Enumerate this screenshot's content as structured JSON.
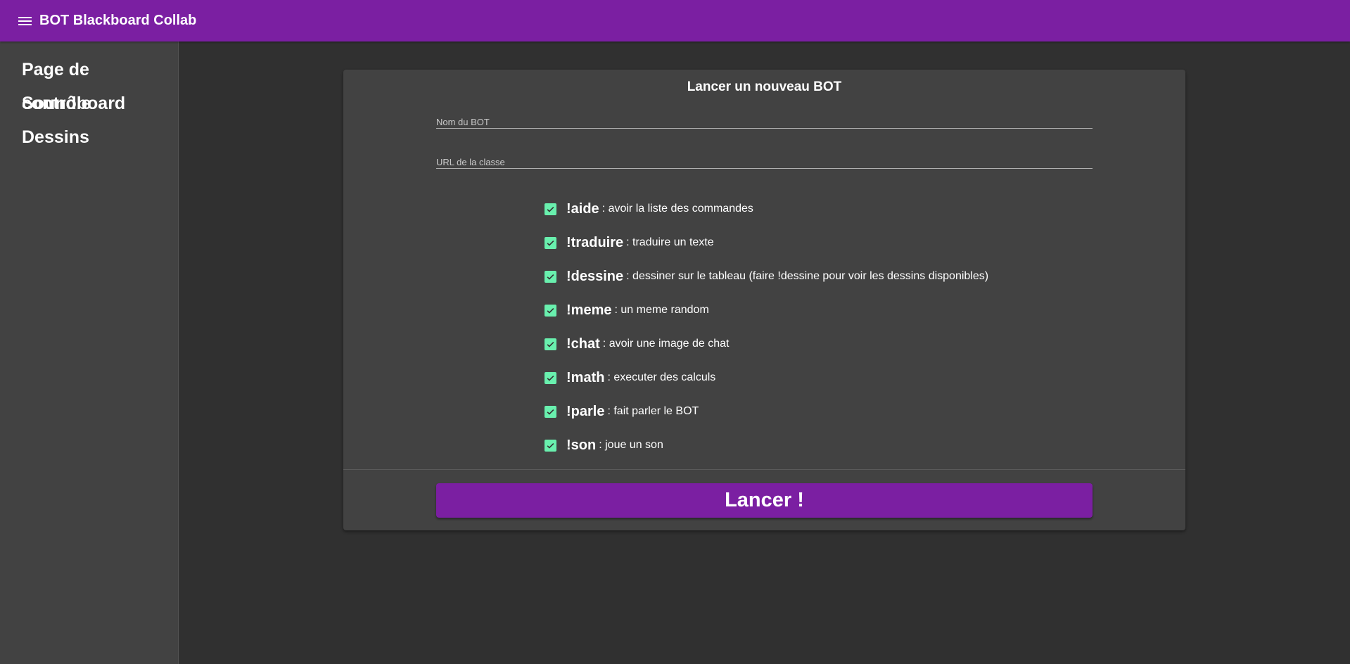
{
  "header": {
    "menu_icon": "menu-icon",
    "title": "BOT Blackboard Collab"
  },
  "sidebar": {
    "items": [
      {
        "label": "Page de contrôle"
      },
      {
        "label": "Soundboard"
      },
      {
        "label": "Dessins"
      }
    ]
  },
  "form": {
    "title": "Lancer un nouveau BOT",
    "name_field": {
      "placeholder": "Nom du BOT",
      "value": ""
    },
    "url_field": {
      "placeholder": "URL de la classe",
      "value": ""
    },
    "commands": [
      {
        "name": "!aide",
        "desc": ": avoir la liste des commandes",
        "checked": true
      },
      {
        "name": "!traduire",
        "desc": ": traduire un texte",
        "checked": true
      },
      {
        "name": "!dessine",
        "desc": ": dessiner sur le tableau (faire !dessine pour voir les dessins disponibles)",
        "checked": true
      },
      {
        "name": "!meme",
        "desc": ": un meme random",
        "checked": true
      },
      {
        "name": "!chat",
        "desc": ": avoir une image de chat",
        "checked": true
      },
      {
        "name": "!math",
        "desc": ": executer des calculs",
        "checked": true
      },
      {
        "name": "!parle",
        "desc": ": fait parler le BOT",
        "checked": true
      },
      {
        "name": "!son",
        "desc": ": joue un son",
        "checked": true
      }
    ],
    "submit_label": "Lancer !"
  },
  "colors": {
    "primary": "#7b1fa2",
    "checkbox_accent": "#69f0ae",
    "background": "#303030",
    "surface": "#424242"
  }
}
